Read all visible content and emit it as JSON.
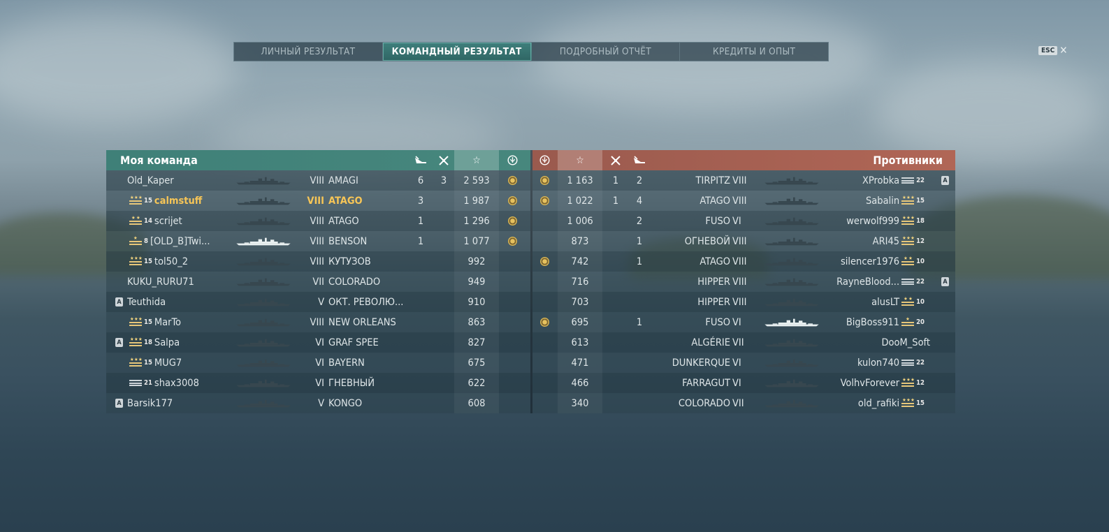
{
  "tabs": [
    {
      "label": "ЛИЧНЫЙ РЕЗУЛЬТАТ",
      "active": false
    },
    {
      "label": "КОМАНДНЫЙ РЕЗУЛЬТАТ",
      "active": true
    },
    {
      "label": "ПОДРОБНЫЙ ОТЧЁТ",
      "active": false
    },
    {
      "label": "КРЕДИТЫ И ОПЫТ",
      "active": false
    }
  ],
  "esc": {
    "key": "ESC",
    "close": "✕"
  },
  "colors": {
    "ally": "#3f8078",
    "enemy": "#b06656",
    "me": "#f6c557"
  },
  "my_team": {
    "title": "Моя команда",
    "header_icons": [
      "ship-kill-icon",
      "plane-kill-icon",
      "star-icon",
      "base-capture-icon"
    ],
    "header_star": "☆",
    "players": [
      {
        "name": "Old_Kaper",
        "rank": "",
        "rank_icon": "none",
        "badge": "",
        "tier": "VIII",
        "ship": "AMAGI",
        "kills": "6",
        "planes": "3",
        "xp": "2 593",
        "medal": true,
        "me": false,
        "hl": false
      },
      {
        "name": "calmstuff",
        "rank": "15",
        "rank_icon": "gold3",
        "badge": "",
        "tier": "VIII",
        "ship": "ATAGO",
        "kills": "3",
        "planes": "",
        "xp": "1 987",
        "medal": true,
        "me": true,
        "hl": false
      },
      {
        "name": "scrijet",
        "rank": "14",
        "rank_icon": "gold2",
        "badge": "",
        "tier": "VIII",
        "ship": "ATAGO",
        "kills": "1",
        "planes": "",
        "xp": "1 296",
        "medal": true,
        "me": false,
        "hl": false
      },
      {
        "name": "[OLD_B]Twi...",
        "rank": "8",
        "rank_icon": "gold1",
        "badge": "",
        "tier": "VIII",
        "ship": "BENSON",
        "kills": "1",
        "planes": "",
        "xp": "1 077",
        "medal": true,
        "me": false,
        "hl": true
      },
      {
        "name": "tol50_2",
        "rank": "15",
        "rank_icon": "gold3",
        "badge": "",
        "tier": "VIII",
        "ship": "КУТУЗОВ",
        "kills": "",
        "planes": "",
        "xp": "992",
        "medal": false,
        "me": false,
        "hl": false
      },
      {
        "name": "KUKU_RURU71",
        "rank": "",
        "rank_icon": "none",
        "badge": "",
        "tier": "VII",
        "ship": "COLORADO",
        "kills": "",
        "planes": "",
        "xp": "949",
        "medal": false,
        "me": false,
        "hl": false
      },
      {
        "name": "Teuthida",
        "rank": "",
        "rank_icon": "none",
        "badge": "A",
        "tier": "V",
        "ship": "ОКТ. РЕВОЛЮ...",
        "kills": "",
        "planes": "",
        "xp": "910",
        "medal": false,
        "me": false,
        "hl": false
      },
      {
        "name": "MarTo",
        "rank": "15",
        "rank_icon": "gold3",
        "badge": "",
        "tier": "VIII",
        "ship": "NEW ORLEANS",
        "kills": "",
        "planes": "",
        "xp": "863",
        "medal": false,
        "me": false,
        "hl": false
      },
      {
        "name": "Salpa",
        "rank": "18",
        "rank_icon": "gold3",
        "badge": "A",
        "tier": "VI",
        "ship": "GRAF SPEE",
        "kills": "",
        "planes": "",
        "xp": "827",
        "medal": false,
        "me": false,
        "hl": false
      },
      {
        "name": "MUG7",
        "rank": "15",
        "rank_icon": "gold3",
        "badge": "",
        "tier": "VI",
        "ship": "BAYERN",
        "kills": "",
        "planes": "",
        "xp": "675",
        "medal": false,
        "me": false,
        "hl": false
      },
      {
        "name": "shax3008",
        "rank": "21",
        "rank_icon": "grey",
        "badge": "",
        "tier": "VI",
        "ship": "ГНЕВНЫЙ",
        "kills": "",
        "planes": "",
        "xp": "622",
        "medal": false,
        "me": false,
        "hl": false
      },
      {
        "name": "Barsik177",
        "rank": "",
        "rank_icon": "none",
        "badge": "A",
        "tier": "V",
        "ship": "KONGO",
        "kills": "",
        "planes": "",
        "xp": "608",
        "medal": false,
        "me": false,
        "hl": false
      }
    ]
  },
  "enemy_team": {
    "title": "Противники",
    "header_star": "☆",
    "players": [
      {
        "name": "XProbka",
        "rank": "22",
        "rank_icon": "grey",
        "badge": "A",
        "tier": "VIII",
        "ship": "TIRPITZ",
        "kills": "1",
        "planes": "2",
        "xp": "1 163",
        "medal": true,
        "hl": false
      },
      {
        "name": "Sabalin",
        "rank": "15",
        "rank_icon": "gold3",
        "badge": "",
        "tier": "VIII",
        "ship": "ATAGO",
        "kills": "1",
        "planes": "4",
        "xp": "1 022",
        "medal": true,
        "hl": false
      },
      {
        "name": "werwolf999",
        "rank": "18",
        "rank_icon": "gold3",
        "badge": "",
        "tier": "VI",
        "ship": "FUSO",
        "kills": "",
        "planes": "2",
        "xp": "1 006",
        "medal": false,
        "hl": false
      },
      {
        "name": "ARI45",
        "rank": "12",
        "rank_icon": "gold3",
        "badge": "",
        "tier": "VIII",
        "ship": "ОГНЕВОЙ",
        "kills": "",
        "planes": "1",
        "xp": "873",
        "medal": false,
        "hl": false
      },
      {
        "name": "silencer1976",
        "rank": "10",
        "rank_icon": "gold2",
        "badge": "",
        "tier": "VIII",
        "ship": "ATAGO",
        "kills": "",
        "planes": "1",
        "xp": "742",
        "medal": true,
        "hl": false
      },
      {
        "name": "RayneBlood...",
        "rank": "22",
        "rank_icon": "grey",
        "badge": "A",
        "tier": "VIII",
        "ship": "HIPPER",
        "kills": "",
        "planes": "",
        "xp": "716",
        "medal": false,
        "hl": false
      },
      {
        "name": "alusLT",
        "rank": "10",
        "rank_icon": "gold2",
        "badge": "",
        "tier": "VIII",
        "ship": "HIPPER",
        "kills": "",
        "planes": "",
        "xp": "703",
        "medal": false,
        "hl": false
      },
      {
        "name": "BigBoss911",
        "rank": "20",
        "rank_icon": "gold1",
        "badge": "",
        "tier": "VI",
        "ship": "FUSO",
        "kills": "",
        "planes": "1",
        "xp": "695",
        "medal": true,
        "hl": true
      },
      {
        "name": "DooM_Soft",
        "rank": "",
        "rank_icon": "none",
        "badge": "",
        "tier": "VII",
        "ship": "ALGÉRIE",
        "kills": "",
        "planes": "",
        "xp": "613",
        "medal": false,
        "hl": false
      },
      {
        "name": "kulon740",
        "rank": "22",
        "rank_icon": "grey",
        "badge": "",
        "tier": "VI",
        "ship": "DUNKERQUE",
        "kills": "",
        "planes": "",
        "xp": "471",
        "medal": false,
        "hl": false
      },
      {
        "name": "VolhvForever",
        "rank": "12",
        "rank_icon": "gold3",
        "badge": "",
        "tier": "VI",
        "ship": "FARRAGUT",
        "kills": "",
        "planes": "",
        "xp": "466",
        "medal": false,
        "hl": false
      },
      {
        "name": "old_rafiki",
        "rank": "15",
        "rank_icon": "gold3",
        "badge": "",
        "tier": "VII",
        "ship": "COLORADO",
        "kills": "",
        "planes": "",
        "xp": "340",
        "medal": false,
        "hl": false
      }
    ]
  }
}
